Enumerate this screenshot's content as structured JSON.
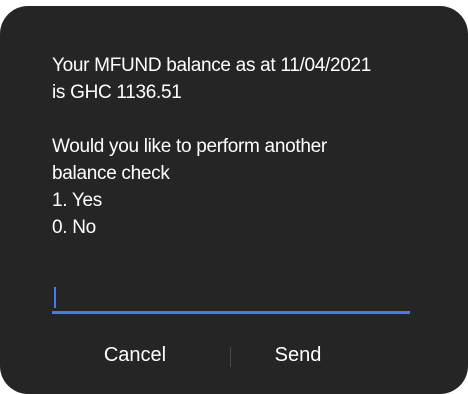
{
  "dialog": {
    "message_lines": [
      "Your MFUND balance as at 11/04/2021",
      "is GHC 1136.51",
      "",
      "Would you like to perform another",
      "balance check",
      "1. Yes",
      "0. No"
    ],
    "input": {
      "value": "",
      "placeholder": ""
    },
    "cancel_label": "Cancel",
    "send_label": "Send"
  },
  "colors": {
    "background": "#252525",
    "text": "#ffffff",
    "accent": "#3d7ef5",
    "divider": "#4a4a4a"
  }
}
